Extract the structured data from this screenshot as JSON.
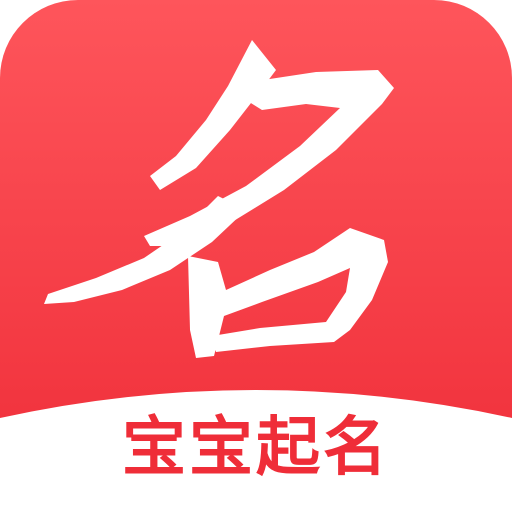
{
  "app_icon": {
    "logo_glyph": "名",
    "app_name": "宝宝起名",
    "colors": {
      "background_top": "#fe555b",
      "background_bottom": "#ef2d38",
      "glyph": "#ffffff",
      "app_name_text": "#ef2d38",
      "base": "#ffffff"
    },
    "icon_name": "brush-calligraphy-logo-icon"
  }
}
